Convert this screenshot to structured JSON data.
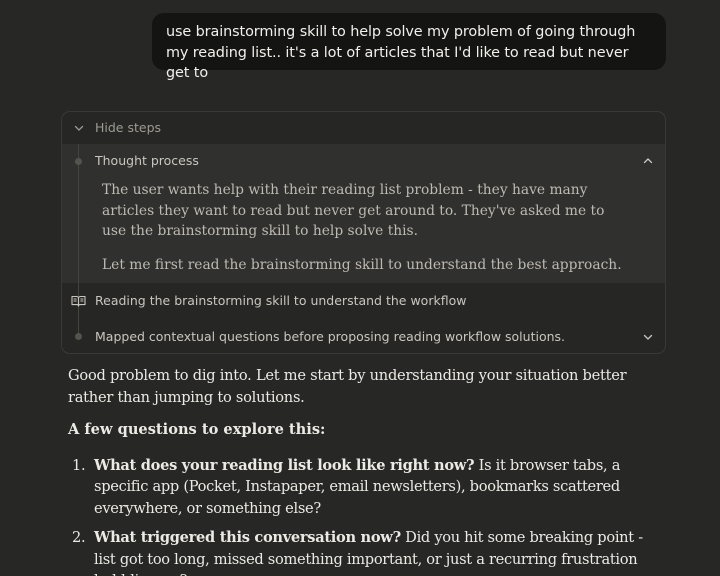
{
  "user_message": "use brainstorming skill to help solve my problem of going through my reading list.. it's a lot of articles that I'd like to read but never get to",
  "steps": {
    "toggle_label": "Hide steps",
    "thought": {
      "label": "Thought process",
      "paragraphs": [
        "The user wants help with their reading list problem - they have many articles they want to read but never get around to. They've asked me to use the brainstorming skill to help solve this.",
        "Let me first read the brainstorming skill to understand the best approach."
      ]
    },
    "reading_step": "Reading the brainstorming skill to understand the workflow",
    "summary_step": "Mapped contextual questions before proposing reading workflow solutions.",
    "icons": {
      "toggle": "chevron-down-icon",
      "collapse": "chevron-up-icon",
      "reading": "book-open-icon",
      "expand": "chevron-down-icon"
    }
  },
  "answer": {
    "intro": "Good problem to dig into. Let me start by understanding your situation better rather than jumping to solutions.",
    "heading": "A few questions to explore this:",
    "questions": [
      {
        "number": "1.",
        "bold": "What does your reading list look like right now?",
        "text": " Is it browser tabs, a specific app (Pocket, Instapaper, email newsletters), bookmarks scattered everywhere, or something else?"
      },
      {
        "number": "2.",
        "bold": "What triggered this conversation now?",
        "text": " Did you hit some breaking point - list got too long, missed something important, or just a recurring frustration bubbling up?"
      }
    ]
  },
  "colors": {
    "background": "#272725",
    "user_bubble": "#141413",
    "thought_block": "#30302e",
    "text_primary": "#eceae5",
    "text_muted": "#9d9a93"
  }
}
